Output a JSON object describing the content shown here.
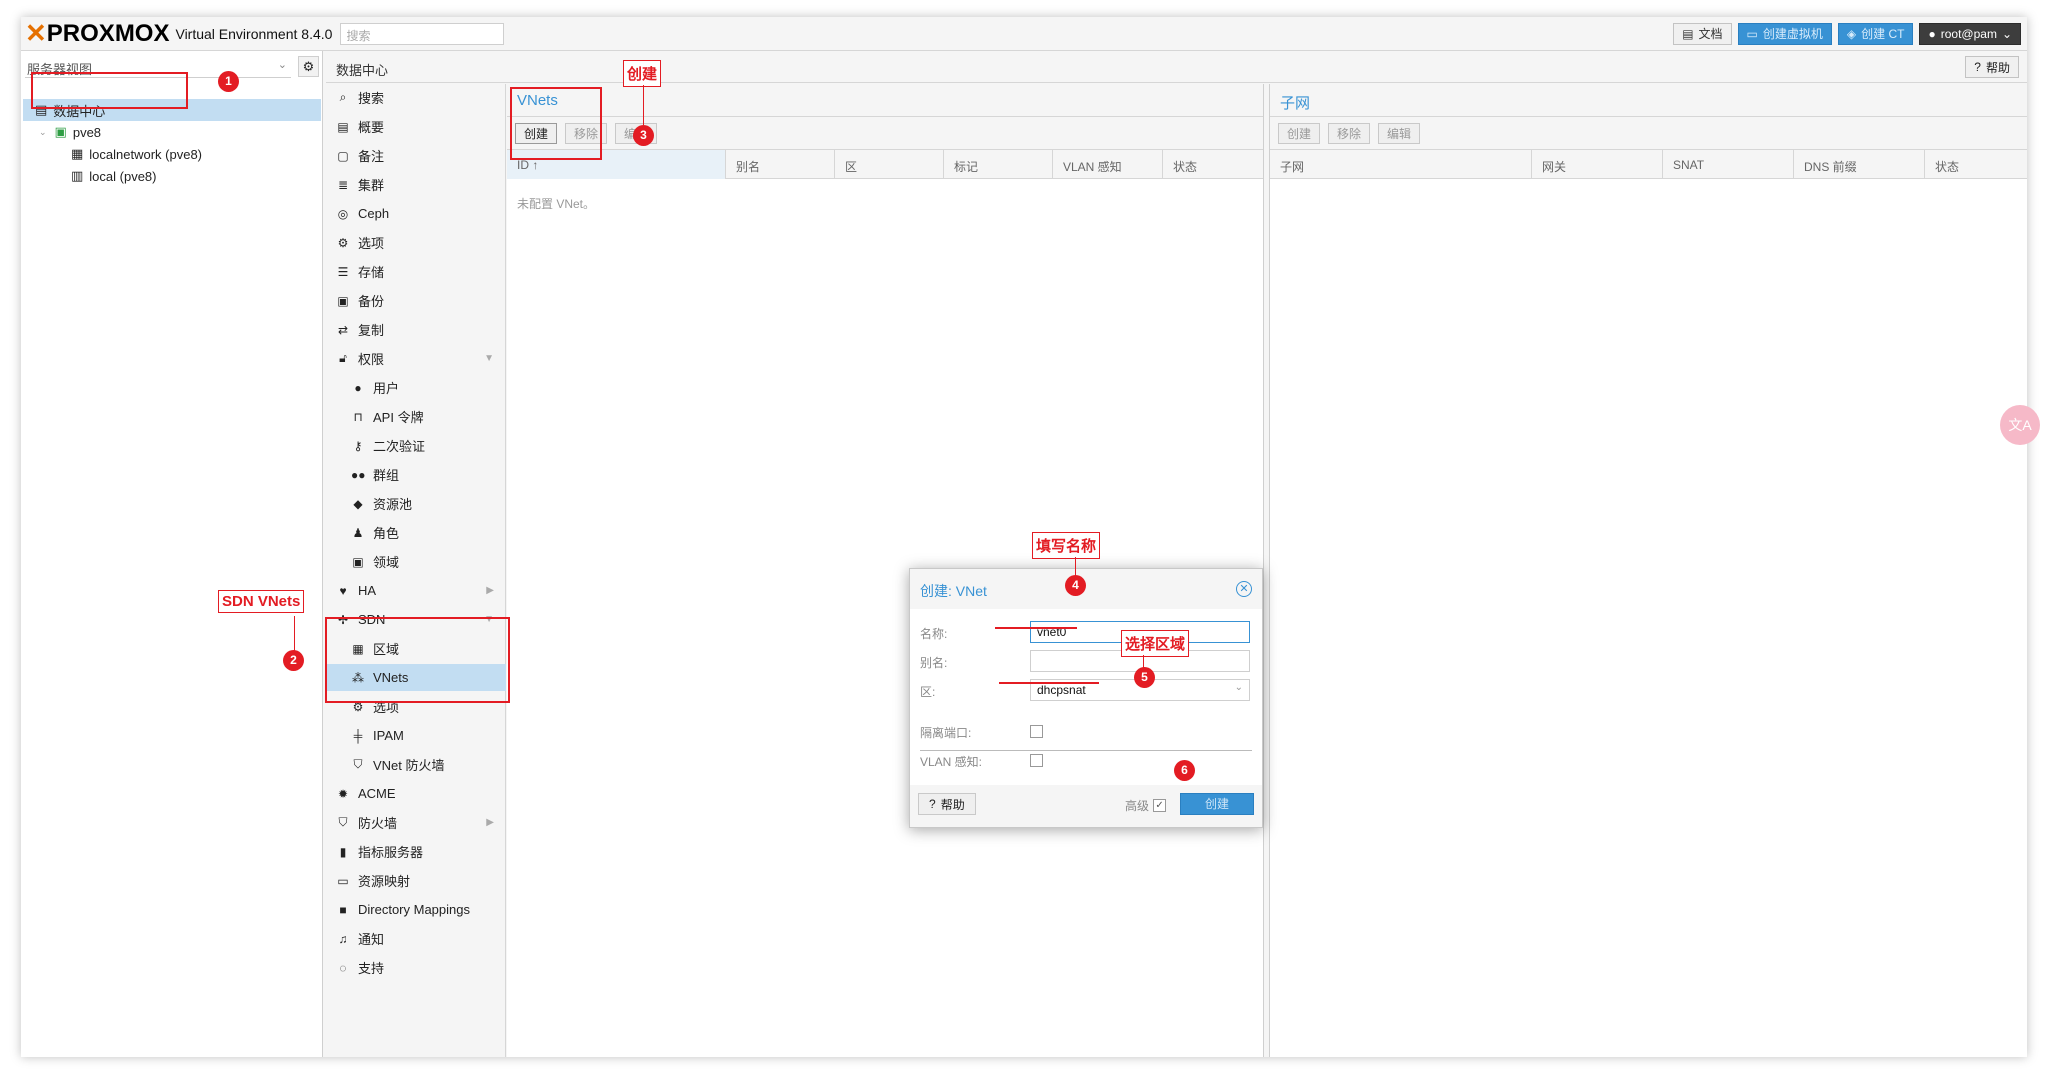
{
  "header": {
    "logo": "PROXMOX",
    "version": "Virtual Environment 8.4.0",
    "search_placeholder": "搜索",
    "docs": "文档",
    "create_vm": "创建虚拟机",
    "create_ct": "创建 CT",
    "user": "root@pam"
  },
  "tree": {
    "view_select": "服务器视图",
    "items": [
      {
        "label": "数据中心"
      },
      {
        "label": "pve8"
      },
      {
        "label": "localnetwork (pve8)"
      },
      {
        "label": "local (pve8)"
      }
    ]
  },
  "nav": {
    "breadcrumb": "数据中心",
    "help": "帮助"
  },
  "menu": {
    "items": [
      {
        "label": "搜索",
        "icon": "search-icon"
      },
      {
        "label": "概要",
        "icon": "book-icon"
      },
      {
        "label": "备注",
        "icon": "note-icon"
      },
      {
        "label": "集群",
        "icon": "server-icon"
      },
      {
        "label": "Ceph",
        "icon": "ceph-icon"
      },
      {
        "label": "选项",
        "icon": "gear-icon"
      },
      {
        "label": "存储",
        "icon": "database-icon"
      },
      {
        "label": "备份",
        "icon": "floppy-icon"
      },
      {
        "label": "复制",
        "icon": "retweet-icon"
      },
      {
        "label": "权限",
        "icon": "unlock-icon"
      },
      {
        "label": "用户",
        "icon": "user-icon"
      },
      {
        "label": "API 令牌",
        "icon": "lock-icon"
      },
      {
        "label": "二次验证",
        "icon": "key-icon"
      },
      {
        "label": "群组",
        "icon": "users-icon"
      },
      {
        "label": "资源池",
        "icon": "tags-icon"
      },
      {
        "label": "角色",
        "icon": "male-icon"
      },
      {
        "label": "领域",
        "icon": "address-book-icon"
      },
      {
        "label": "HA",
        "icon": "heartbeat-icon"
      },
      {
        "label": "SDN",
        "icon": "sdn-icon"
      },
      {
        "label": "区域",
        "icon": "grid-icon"
      },
      {
        "label": "VNets",
        "icon": "network-icon"
      },
      {
        "label": "选项",
        "icon": "gear-icon"
      },
      {
        "label": "IPAM",
        "icon": "ipam-icon"
      },
      {
        "label": "VNet 防火墙",
        "icon": "shield-icon"
      },
      {
        "label": "ACME",
        "icon": "certificate-icon"
      },
      {
        "label": "防火墙",
        "icon": "shield-icon"
      },
      {
        "label": "指标服务器",
        "icon": "bar-chart-icon"
      },
      {
        "label": "资源映射",
        "icon": "folder-icon"
      },
      {
        "label": "Directory Mappings",
        "icon": "folder-icon"
      },
      {
        "label": "通知",
        "icon": "bell-icon"
      },
      {
        "label": "支持",
        "icon": "comments-icon"
      }
    ]
  },
  "vnets": {
    "title": "VNets",
    "toolbar": {
      "create": "创建",
      "remove": "移除",
      "edit": "编辑"
    },
    "columns": [
      "ID ↑",
      "别名",
      "区",
      "标记",
      "VLAN 感知",
      "状态"
    ],
    "empty": "未配置 VNet。"
  },
  "subnets": {
    "title": "子网",
    "toolbar": {
      "create": "创建",
      "remove": "移除",
      "edit": "编辑"
    },
    "columns": [
      "子网",
      "网关",
      "SNAT",
      "DNS 前缀",
      "状态"
    ]
  },
  "dialog": {
    "title": "创建: VNet",
    "name_label": "名称:",
    "name_value": "vnet0",
    "alias_label": "别名:",
    "alias_value": "",
    "zone_label": "区:",
    "zone_value": "dhcpsnat",
    "isolate_label": "隔离端口:",
    "vlan_label": "VLAN 感知:",
    "help": "帮助",
    "advanced": "高级",
    "create": "创建"
  },
  "annotations": {
    "n1": "1",
    "n2": "2",
    "n3": "3",
    "n4": "4",
    "n5": "5",
    "n6": "6",
    "tag_sdn": "SDN VNets",
    "tag_create": "创建",
    "tag_name": "填写名称",
    "tag_zone": "选择区域"
  },
  "colors": {
    "accent": "#3892d4",
    "annotation": "#e31c23",
    "selected": "#c2ddf2",
    "logo_x": "#e57000"
  }
}
